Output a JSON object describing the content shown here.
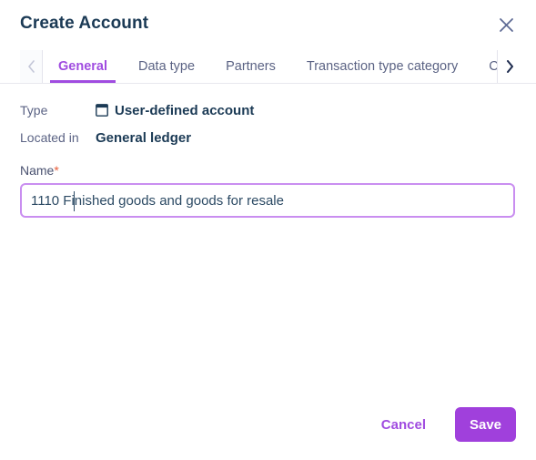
{
  "dialog": {
    "title": "Create Account",
    "close_icon": "close-icon"
  },
  "tabs": {
    "prev_icon": "chevron-left-icon",
    "next_icon": "chevron-right-icon",
    "items": [
      {
        "label": "General",
        "active": true
      },
      {
        "label": "Data type",
        "active": false
      },
      {
        "label": "Partners",
        "active": false
      },
      {
        "label": "Transaction type category",
        "active": false
      },
      {
        "label": "Curre",
        "active": false
      }
    ]
  },
  "form": {
    "type": {
      "label": "Type",
      "icon": "account-card-icon",
      "value": "User-defined account"
    },
    "located_in": {
      "label": "Located in",
      "value": "General ledger"
    },
    "name": {
      "label": "Name",
      "required_marker": "*",
      "value": "1110 Finished goods and goods for resale",
      "placeholder": ""
    }
  },
  "footer": {
    "cancel_label": "Cancel",
    "save_label": "Save"
  },
  "colors": {
    "accent_purple": "#a040dc",
    "title_navy": "#1b3a55",
    "label_gray": "#5b6384",
    "required_orange": "#e8603c",
    "input_border_focus": "#c98ef0"
  }
}
